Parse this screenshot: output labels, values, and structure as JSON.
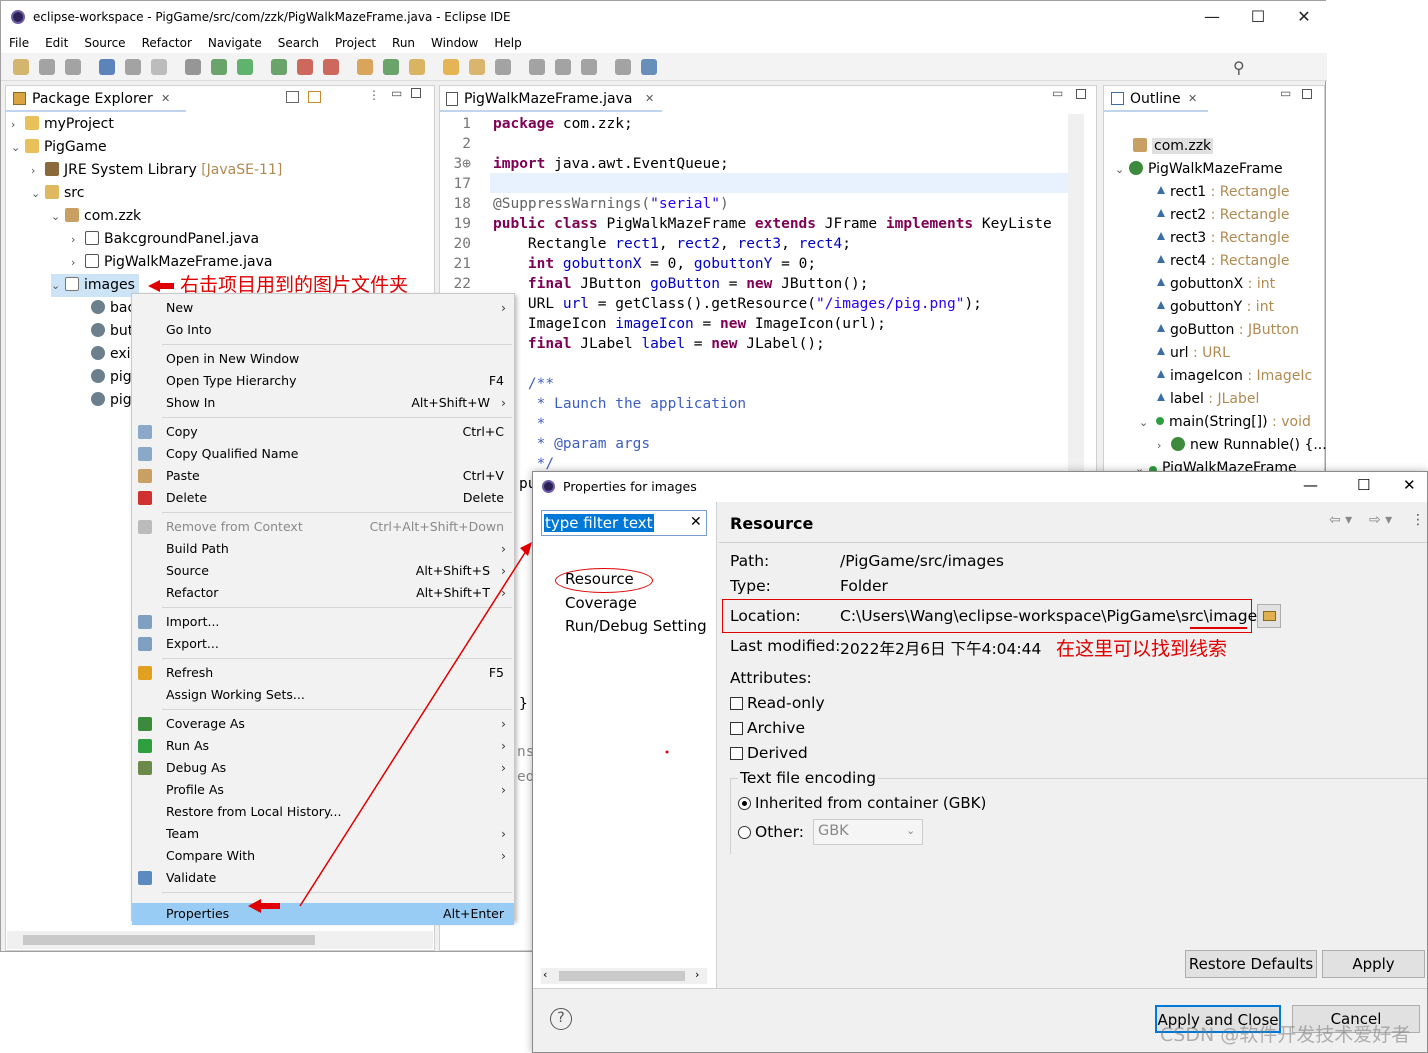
{
  "window": {
    "title": "eclipse-workspace - PigGame/src/com/zzk/PigWalkMazeFrame.java - Eclipse IDE"
  },
  "menu": [
    "File",
    "Edit",
    "Source",
    "Refactor",
    "Navigate",
    "Search",
    "Project",
    "Run",
    "Window",
    "Help"
  ],
  "package_explorer": {
    "tab": "Package Explorer",
    "items": {
      "myproject": "myProject",
      "piggame": "PigGame",
      "jre": "JRE System Library",
      "jre_ver": "[JavaSE-11]",
      "src": "src",
      "pkg": "com.zzk",
      "file1": "BakcgroundPanel.java",
      "file2": "PigWalkMazeFrame.java",
      "images": "images",
      "sub": [
        "bac",
        "but",
        "exi",
        "pig",
        "pig"
      ]
    }
  },
  "editor": {
    "tab": "PigWalkMazeFrame.java",
    "lines": [
      {
        "n": "1",
        "code": [
          {
            "t": "package",
            "c": "kw"
          },
          {
            "t": " com.zzk;"
          }
        ]
      },
      {
        "n": "2",
        "code": []
      },
      {
        "n": "3⊕",
        "code": [
          {
            "t": "import",
            "c": "kw"
          },
          {
            "t": " java.awt.EventQueue;"
          }
        ]
      },
      {
        "n": "17",
        "code": []
      },
      {
        "n": "18",
        "code": [
          {
            "t": "@SuppressWarnings(",
            "c": "ann"
          },
          {
            "t": "\"serial\"",
            "c": "str"
          },
          {
            "t": ")",
            "c": "ann"
          }
        ]
      },
      {
        "n": "19",
        "code": [
          {
            "t": "public class",
            "c": "kw"
          },
          {
            "t": " PigWalkMazeFrame "
          },
          {
            "t": "extends",
            "c": "kw"
          },
          {
            "t": " JFrame "
          },
          {
            "t": "implements",
            "c": "kw"
          },
          {
            "t": " KeyListe"
          }
        ]
      },
      {
        "n": "20",
        "code": [
          {
            "t": "    Rectangle "
          },
          {
            "t": "rect1",
            "c": "fld"
          },
          {
            "t": ", "
          },
          {
            "t": "rect2",
            "c": "fld"
          },
          {
            "t": ", "
          },
          {
            "t": "rect3",
            "c": "fld"
          },
          {
            "t": ", "
          },
          {
            "t": "rect4",
            "c": "fld"
          },
          {
            "t": ";"
          }
        ]
      },
      {
        "n": "21",
        "code": [
          {
            "t": "    "
          },
          {
            "t": "int",
            "c": "kw"
          },
          {
            "t": " "
          },
          {
            "t": "gobuttonX",
            "c": "fld"
          },
          {
            "t": " = 0, "
          },
          {
            "t": "gobuttonY",
            "c": "fld"
          },
          {
            "t": " = 0;"
          }
        ]
      },
      {
        "n": "22",
        "code": [
          {
            "t": "    "
          },
          {
            "t": "final",
            "c": "kw"
          },
          {
            "t": " JButton "
          },
          {
            "t": "goButton",
            "c": "fld"
          },
          {
            "t": " = "
          },
          {
            "t": "new",
            "c": "kw"
          },
          {
            "t": " JButton();"
          }
        ]
      },
      {
        "n": "",
        "code": [
          {
            "t": "    URL "
          },
          {
            "t": "url",
            "c": "fld"
          },
          {
            "t": " = getClass().getResource("
          },
          {
            "t": "\"/images/pig.png\"",
            "c": "str"
          },
          {
            "t": ");"
          }
        ]
      },
      {
        "n": "",
        "code": [
          {
            "t": "    ImageIcon "
          },
          {
            "t": "imageIcon",
            "c": "fld"
          },
          {
            "t": " = "
          },
          {
            "t": "new",
            "c": "kw"
          },
          {
            "t": " ImageIcon(url);"
          }
        ]
      },
      {
        "n": "",
        "code": [
          {
            "t": "    "
          },
          {
            "t": "final",
            "c": "kw"
          },
          {
            "t": " JLabel "
          },
          {
            "t": "label",
            "c": "fld"
          },
          {
            "t": " = "
          },
          {
            "t": "new",
            "c": "kw"
          },
          {
            "t": " JLabel();"
          }
        ]
      },
      {
        "n": "",
        "code": []
      },
      {
        "n": "",
        "code": [
          {
            "t": "    /**",
            "c": "cmt"
          }
        ]
      },
      {
        "n": "",
        "code": [
          {
            "t": "     * Launch the application",
            "c": "cmt"
          }
        ]
      },
      {
        "n": "",
        "code": [
          {
            "t": "     *",
            "c": "cmt"
          }
        ]
      },
      {
        "n": "",
        "code": [
          {
            "t": "     * @param args",
            "c": "cmt"
          }
        ]
      },
      {
        "n": "",
        "code": [
          {
            "t": "     */",
            "c": "cmt"
          }
        ]
      }
    ],
    "tail": "pu",
    "brace": "}",
    "frag1": "ns",
    "frag2": "ed"
  },
  "outline": {
    "tab": "Outline",
    "pkg": "com.zzk",
    "cls": "PigWalkMazeFrame",
    "members": [
      {
        "name": "rect1",
        "type": " : Rectangle"
      },
      {
        "name": "rect2",
        "type": " : Rectangle"
      },
      {
        "name": "rect3",
        "type": " : Rectangle"
      },
      {
        "name": "rect4",
        "type": " : Rectangle"
      },
      {
        "name": "gobuttonX",
        "type": " : int"
      },
      {
        "name": "gobuttonY",
        "type": " : int"
      },
      {
        "name": "goButton",
        "type": " : JButton"
      },
      {
        "name": "url",
        "type": " : URL"
      },
      {
        "name": "imageIcon",
        "type": " : ImageIc"
      },
      {
        "name": "label",
        "type": " : JLabel"
      },
      {
        "name": "main(String[])",
        "type": " : void"
      }
    ],
    "runnable": "new Runnable() {...",
    "cls2": "PigWalkMazeFrame"
  },
  "context_menu": [
    {
      "label": "New",
      "arrow": true
    },
    {
      "label": "Go Into"
    },
    {
      "sep": true
    },
    {
      "label": "Open in New Window"
    },
    {
      "label": "Open Type Hierarchy",
      "sc": "F4"
    },
    {
      "label": "Show In",
      "sc": "Alt+Shift+W",
      "arrow": true
    },
    {
      "sep": true
    },
    {
      "label": "Copy",
      "sc": "Ctrl+C",
      "icon": "copy-icon"
    },
    {
      "label": "Copy Qualified Name",
      "icon": "copy-qualified-icon"
    },
    {
      "label": "Paste",
      "sc": "Ctrl+V",
      "icon": "paste-icon"
    },
    {
      "label": "Delete",
      "sc": "Delete",
      "icon": "delete-icon"
    },
    {
      "sep": true
    },
    {
      "label": "Remove from Context",
      "sc": "Ctrl+Alt+Shift+Down",
      "disabled": true,
      "icon": "remove-context-icon"
    },
    {
      "label": "Build Path",
      "arrow": true
    },
    {
      "label": "Source",
      "sc": "Alt+Shift+S",
      "arrow": true
    },
    {
      "label": "Refactor",
      "sc": "Alt+Shift+T",
      "arrow": true
    },
    {
      "sep": true
    },
    {
      "label": "Import...",
      "icon": "import-icon"
    },
    {
      "label": "Export...",
      "icon": "export-icon"
    },
    {
      "sep": true
    },
    {
      "label": "Refresh",
      "sc": "F5",
      "icon": "refresh-icon"
    },
    {
      "label": "Assign Working Sets..."
    },
    {
      "sep": true
    },
    {
      "label": "Coverage As",
      "arrow": true,
      "icon": "coverage-icon"
    },
    {
      "label": "Run As",
      "arrow": true,
      "icon": "run-icon"
    },
    {
      "label": "Debug As",
      "arrow": true,
      "icon": "debug-icon"
    },
    {
      "label": "Profile As",
      "arrow": true
    },
    {
      "label": "Restore from Local History..."
    },
    {
      "label": "Team",
      "arrow": true
    },
    {
      "label": "Compare With",
      "arrow": true
    },
    {
      "label": "Validate",
      "icon": "validate-icon"
    },
    {
      "sep": true
    },
    {
      "label": "Properties",
      "sc": "Alt+Enter",
      "selected": true
    }
  ],
  "annotations": {
    "images_note": "右击项目用到的图片文件夹",
    "location_note": "在这里可以找到线索"
  },
  "dialog": {
    "title": "Properties for images",
    "filter_placeholder": "type filter text",
    "nav": [
      "Resource",
      "Coverage",
      "Run/Debug Setting"
    ],
    "heading": "Resource",
    "path_label": "Path:",
    "path_value": "/PigGame/src/images",
    "type_label": "Type:",
    "type_value": "Folder",
    "location_label": "Location:",
    "location_value": "C:\\Users\\Wang\\eclipse-workspace\\PigGame\\src\\images",
    "modified_label": "Last modified:",
    "modified_value": "2022年2月6日 下午4:04:44",
    "attributes": "Attributes:",
    "readonly": "Read-only",
    "archive": "Archive",
    "derived": "Derived",
    "encoding_group": "Text file encoding",
    "inherited": "Inherited from container (GBK)",
    "other": "Other:",
    "other_value": "GBK",
    "restore": "Restore Defaults",
    "apply": "Apply",
    "apply_close": "Apply and Close",
    "cancel": "Cancel"
  },
  "watermark": "CSDN @软件开发技术爱好者"
}
